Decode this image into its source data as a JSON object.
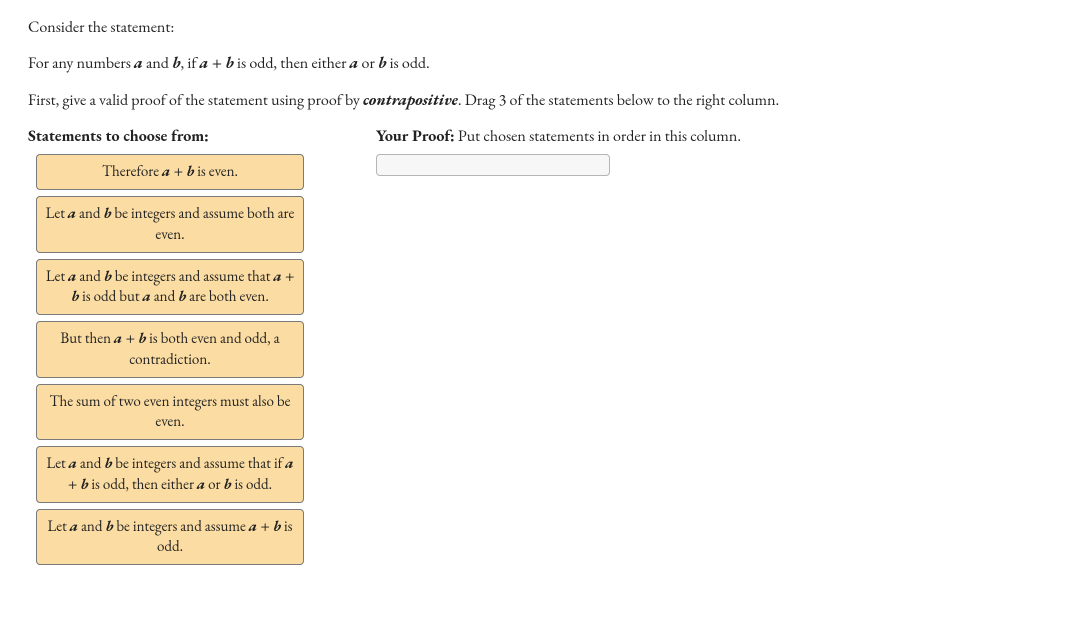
{
  "prompt": {
    "line1_a": "Consider the statement:",
    "line2_a": "For any numbers ",
    "line2_b": " and ",
    "line2_c": ", if ",
    "line2_d": " is odd, then either ",
    "line2_e": " or ",
    "line2_f": " is odd.",
    "line3_a": "First, give a valid proof of the statement using proof by ",
    "line3_b": ". Drag 3 of the statements below to the right column.",
    "term_a": "a",
    "term_b": "b",
    "term_ab": "a + b",
    "term_contrapositive": "contrapositive"
  },
  "headers": {
    "left": "Statements to choose from:",
    "right_lead": "Your Proof:",
    "right_tail": " Put chosen statements in order in this column."
  },
  "tiles": [
    {
      "parts": [
        {
          "t": "Therefore ",
          "s": ""
        },
        {
          "t": "a + b",
          "s": "bi"
        },
        {
          "t": " is even.",
          "s": ""
        }
      ]
    },
    {
      "parts": [
        {
          "t": "Let ",
          "s": ""
        },
        {
          "t": "a",
          "s": "bi"
        },
        {
          "t": " and ",
          "s": ""
        },
        {
          "t": "b",
          "s": "bi"
        },
        {
          "t": " be integers and assume both are even.",
          "s": ""
        }
      ]
    },
    {
      "parts": [
        {
          "t": "Let ",
          "s": ""
        },
        {
          "t": "a",
          "s": "bi"
        },
        {
          "t": " and ",
          "s": ""
        },
        {
          "t": "b",
          "s": "bi"
        },
        {
          "t": " be integers and assume that ",
          "s": ""
        },
        {
          "t": "a + b",
          "s": "bi"
        },
        {
          "t": " is odd but ",
          "s": ""
        },
        {
          "t": "a",
          "s": "bi"
        },
        {
          "t": " and ",
          "s": ""
        },
        {
          "t": "b",
          "s": "bi"
        },
        {
          "t": " are both even.",
          "s": ""
        }
      ]
    },
    {
      "parts": [
        {
          "t": "But then ",
          "s": ""
        },
        {
          "t": "a + b",
          "s": "bi"
        },
        {
          "t": " is both even and odd, a contradiction.",
          "s": ""
        }
      ]
    },
    {
      "parts": [
        {
          "t": "The sum of two even integers must also be even.",
          "s": ""
        }
      ]
    },
    {
      "parts": [
        {
          "t": "Let ",
          "s": ""
        },
        {
          "t": "a",
          "s": "bi"
        },
        {
          "t": " and ",
          "s": ""
        },
        {
          "t": "b",
          "s": "bi"
        },
        {
          "t": " be integers and assume that if ",
          "s": ""
        },
        {
          "t": "a + b",
          "s": "bi"
        },
        {
          "t": " is odd, then either ",
          "s": ""
        },
        {
          "t": "a",
          "s": "bi"
        },
        {
          "t": " or ",
          "s": ""
        },
        {
          "t": "b",
          "s": "bi"
        },
        {
          "t": " is odd.",
          "s": ""
        }
      ]
    },
    {
      "parts": [
        {
          "t": "Let ",
          "s": ""
        },
        {
          "t": "a",
          "s": "bi"
        },
        {
          "t": " and ",
          "s": ""
        },
        {
          "t": "b",
          "s": "bi"
        },
        {
          "t": " be integers and assume ",
          "s": ""
        },
        {
          "t": "a + b",
          "s": "bi"
        },
        {
          "t": " is odd.",
          "s": ""
        }
      ]
    }
  ]
}
